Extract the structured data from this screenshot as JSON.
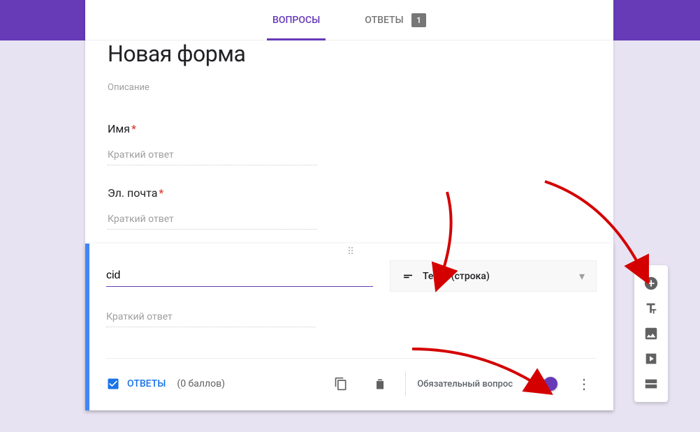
{
  "tabs": {
    "questions": "ВОПРОСЫ",
    "answers": "ОТВЕТЫ",
    "badge": "1"
  },
  "form": {
    "title": "Новая форма",
    "description_ph": "Описание"
  },
  "q1": {
    "label": "Имя",
    "answer_ph": "Краткий ответ"
  },
  "q2": {
    "label": "Эл. почта",
    "answer_ph": "Краткий ответ"
  },
  "editing": {
    "question_value": "cid",
    "type_label": "Текст (строка)",
    "answer_ph": "Краткий ответ",
    "answers_link": "ОТВЕТЫ",
    "points": "(0 баллов)",
    "required_label": "Обязательный вопрос"
  }
}
